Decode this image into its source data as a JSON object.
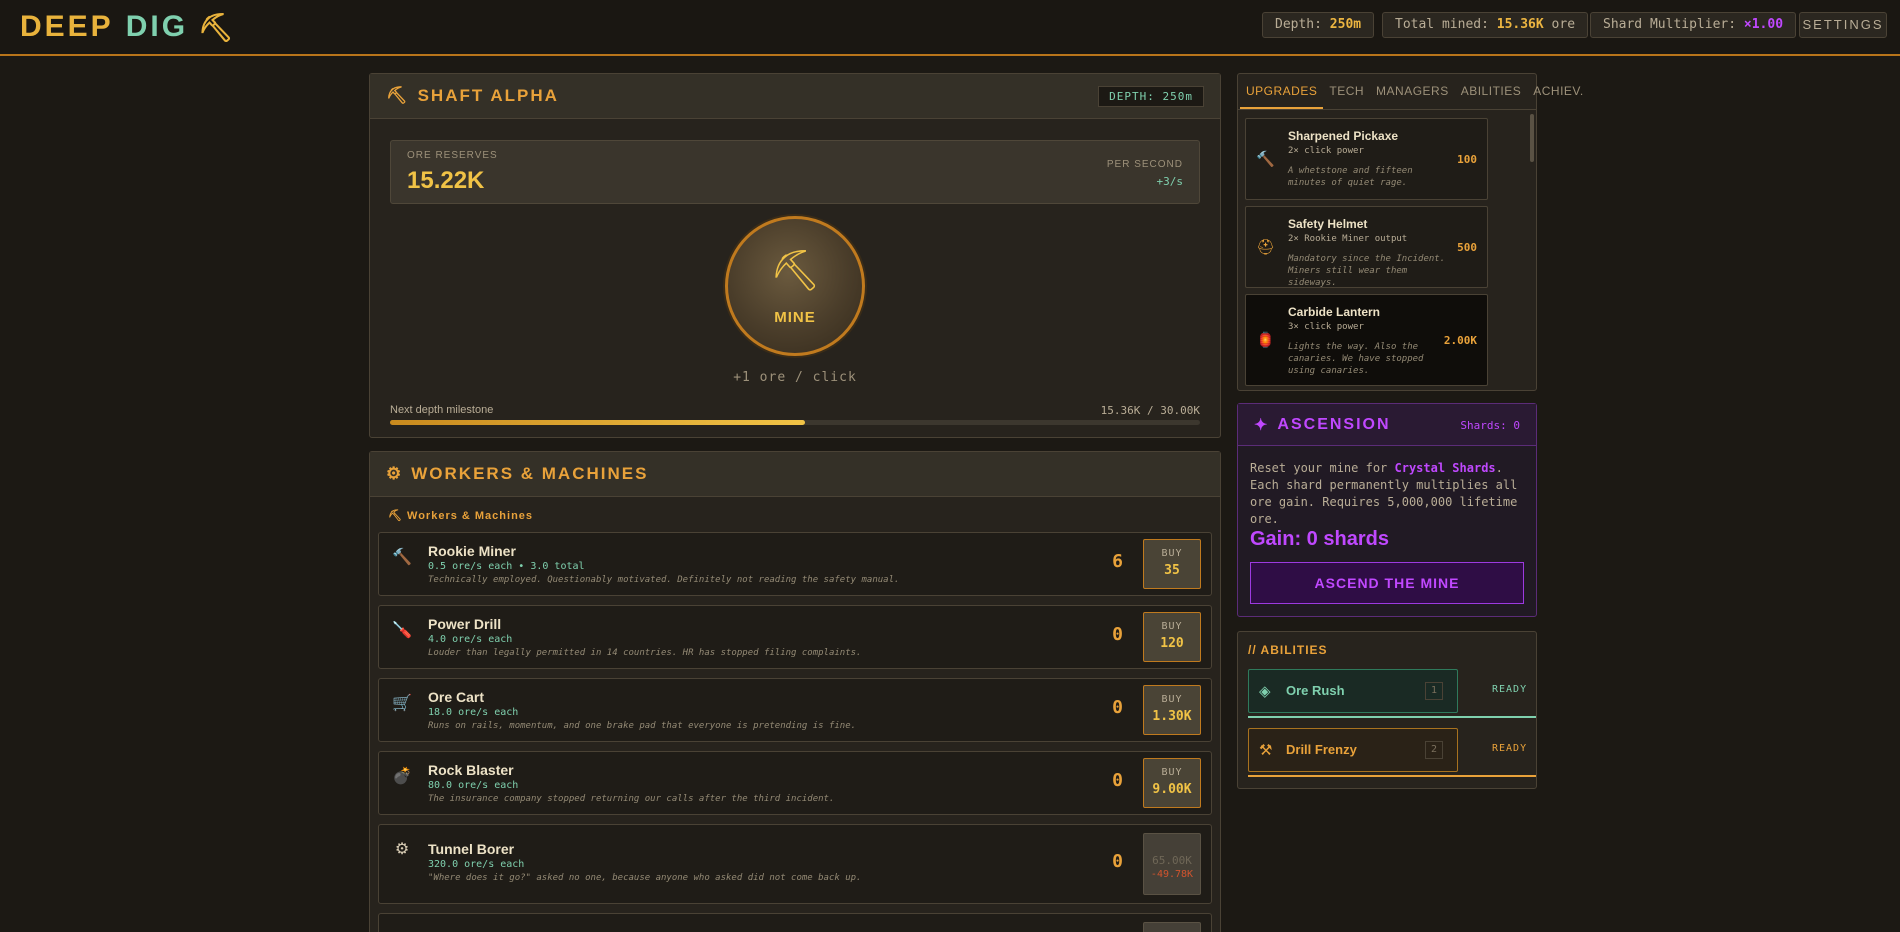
{
  "header": {
    "logo_word1": "DEEP",
    "logo_word2": "DIG",
    "logo_icon": "⛏",
    "depth_label": "Depth:",
    "depth_value": "250m",
    "total_label": "Total mined:",
    "total_value": "15.36K",
    "total_unit": "ore",
    "multiplier_label": "Shard Multiplier:",
    "multiplier_value": "×1.00",
    "settings_label": "SETTINGS"
  },
  "shaft": {
    "title_icon": "⛏",
    "title": "SHAFT ALPHA",
    "depth_badge": "DEPTH: 250m",
    "reserves_label": "ORE RESERVES",
    "reserves_value": "15.22K",
    "per_second_label": "PER SECOND",
    "per_second_value": "+3/s",
    "mine_icon": "⛏",
    "mine_label": "MINE",
    "per_click": "+1 ore / click",
    "milestone_label": "Next depth milestone",
    "milestone_value": "15.36K / 30.00K",
    "milestone_progress": 0.512
  },
  "workers": {
    "title_icon": "⚙",
    "title": "WORKERS & MACHINES",
    "subtitle": "⛏ Workers & Machines",
    "buy_label": "BUY",
    "items": [
      {
        "icon": "🔨",
        "name": "Rookie Miner",
        "rate": "0.5 ore/s each • 3.0 total",
        "desc": "Technically employed. Questionably motivated. Definitely not reading the safety manual.",
        "count": "6",
        "cost": "35",
        "affordable": true
      },
      {
        "icon": "🪛",
        "name": "Power Drill",
        "rate": "4.0 ore/s each",
        "desc": "Louder than legally permitted in 14 countries. HR has stopped filing complaints.",
        "count": "0",
        "cost": "120",
        "affordable": true
      },
      {
        "icon": "🛒",
        "name": "Ore Cart",
        "rate": "18.0 ore/s each",
        "desc": "Runs on rails, momentum, and one brake pad that everyone is pretending is fine.",
        "count": "0",
        "cost": "1.30K",
        "affordable": true
      },
      {
        "icon": "💣",
        "name": "Rock Blaster",
        "rate": "80.0 ore/s each",
        "desc": "The insurance company stopped returning our calls after the third incident.",
        "count": "0",
        "cost": "9.00K",
        "affordable": true
      },
      {
        "icon": "⚙",
        "name": "Tunnel Borer",
        "rate": "320.0 ore/s each",
        "desc": "\"Where does it go?\" asked no one, because anyone who asked did not come back up.",
        "count": "0",
        "cost": "65.00K",
        "shortfall": "-49.78K",
        "affordable": false
      }
    ]
  },
  "upgrades": {
    "tabs": [
      "UPGRADES",
      "TECH",
      "MANAGERS",
      "ABILITIES",
      "ACHIEV."
    ],
    "active_tab": "UPGRADES",
    "items": [
      {
        "icon": "🔨",
        "name": "Sharpened Pickaxe",
        "effect": "2× click power",
        "desc": "A whetstone and fifteen minutes of quiet rage.",
        "price": "100"
      },
      {
        "icon": "⛑",
        "name": "Safety Helmet",
        "effect": "2× Rookie Miner output",
        "desc": "Mandatory since the Incident. Miners still wear them sideways.",
        "price": "500"
      },
      {
        "icon": "🏮",
        "name": "Carbide Lantern",
        "effect": "3× click power",
        "desc": "Lights the way. Also the canaries. We have stopped using canaries.",
        "price": "2.00K"
      }
    ]
  },
  "ascension": {
    "icon": "✦",
    "title": "ASCENSION",
    "shards": "Shards: 0",
    "text_pre": "Reset your mine for ",
    "text_highlight": "Crystal Shards",
    "text_post": ". Each shard permanently multiplies all ore gain. Requires 5,000,000 lifetime ore.",
    "gain": "Gain: 0 shards",
    "button": "ASCEND THE MINE"
  },
  "abilities": {
    "title": "// ABILITIES",
    "items": [
      {
        "icon": "◈",
        "name": "Ore Rush",
        "key": "1",
        "status": "READY",
        "color": "#7fd0ae",
        "border": "#2f7a5c",
        "bg": "#1a2a24"
      },
      {
        "icon": "⚒",
        "name": "Drill Frenzy",
        "key": "2",
        "status": "READY",
        "color": "#e9a23a",
        "border": "#a8721f",
        "bg": "#2a2217"
      }
    ]
  },
  "colors": {
    "accent": "#e9a23a",
    "gold": "#f1c346",
    "teal": "#7fd0ae",
    "purple": "#c048ff",
    "danger": "#d1542e"
  }
}
